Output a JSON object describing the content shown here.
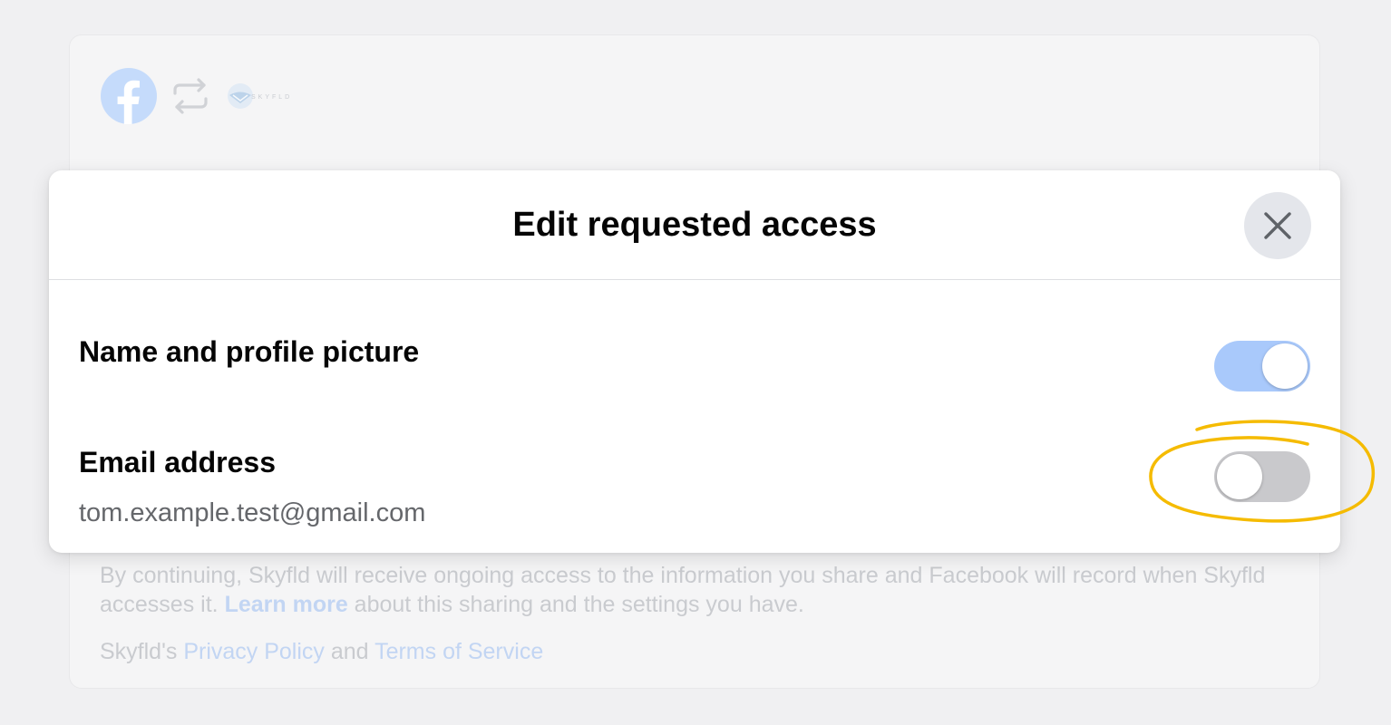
{
  "background_card": {
    "logos": {
      "facebook": "facebook-logo",
      "swap": "swap-arrows-icon",
      "app_wordmark": "SKYFLD"
    },
    "disclosure": {
      "part1": "By continuing, Skyfld will receive ongoing access to the information you share and Facebook will record when Skyfld accesses it. ",
      "learn_more": "Learn more",
      "part2": " about this sharing and the settings you have."
    },
    "legal": {
      "prefix": "Skyfld's ",
      "privacy_policy": "Privacy Policy",
      "and": " and ",
      "terms_of_service": "Terms of Service"
    }
  },
  "modal": {
    "title": "Edit requested access",
    "close_icon": "close-icon",
    "permissions": [
      {
        "label": "Name and profile picture",
        "enabled": true
      },
      {
        "label": "Email address",
        "detail": "tom.example.test@gmail.com",
        "enabled": false
      }
    ]
  },
  "colors": {
    "toggle_on": "#a9c9fb",
    "toggle_off": "#c9c9cc",
    "annotation": "#f5bb00",
    "facebook_blue_dimmed": "#c5dbfb",
    "link_dimmed": "#c2d5f3"
  }
}
